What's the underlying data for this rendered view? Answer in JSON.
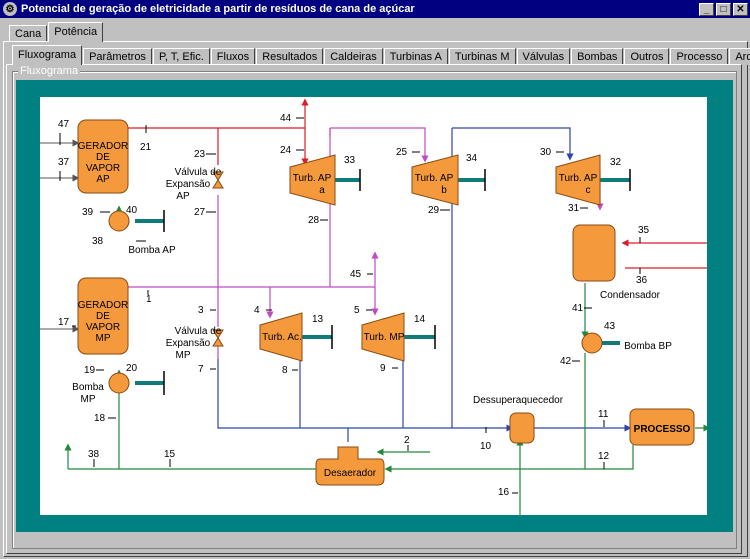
{
  "window": {
    "title": "Potencial de geração de eletricidade a partir de resíduos de cana de açúcar",
    "minimize": "_",
    "maximize": "□",
    "close": "✕"
  },
  "top_tabs": [
    "Cana",
    "Potência"
  ],
  "sub_tabs": [
    "Fluxograma",
    "Parâmetros",
    "P, T, Efic.",
    "Fluxos",
    "Resultados",
    "Caldeiras",
    "Turbinas A",
    "Turbinas M",
    "Válvulas",
    "Bombas",
    "Outros",
    "Processo",
    "Arquivos"
  ],
  "groupbox_label": "Fluxograma",
  "components": {
    "gerador_ap": [
      "GERADOR",
      "DE",
      "VAPOR",
      "AP"
    ],
    "gerador_mp": [
      "GERADOR",
      "DE",
      "VAPOR",
      "MP"
    ],
    "turb_ap_a": [
      "Turb. AP",
      "a"
    ],
    "turb_ap_b": [
      "Turb. AP",
      "b"
    ],
    "turb_ap_c": [
      "Turb. AP",
      "c"
    ],
    "turb_ac": "Turb. Ac.",
    "turb_mp": "Turb. MP",
    "processo": "PROCESSO",
    "desaerador": "Desaerador",
    "valve_ap": [
      "Válvula de",
      "Expansão",
      "AP"
    ],
    "valve_mp": [
      "Válvula de",
      "Expansão",
      "MP"
    ],
    "bomba_ap": "Bomba AP",
    "bomba_mp": [
      "Bomba",
      "MP"
    ],
    "bomba_bp": "Bomba BP",
    "condensador": "Condensador",
    "dessuperaquecedor": "Dessuperaquecedor"
  },
  "stream_numbers": {
    "s47": "47",
    "s37": "37",
    "s21": "21",
    "s39": "39",
    "s40": "40",
    "s38a": "38",
    "s23": "23",
    "s27": "27",
    "s44": "44",
    "s24": "24",
    "s33": "33",
    "s28": "28",
    "s25": "25",
    "s34": "34",
    "s29": "29",
    "s30": "30",
    "s32": "32",
    "s31": "31",
    "s35": "35",
    "s36": "36",
    "s41": "41",
    "s43": "43",
    "s42": "42",
    "s1": "1",
    "s17": "17",
    "s19": "19",
    "s20": "20",
    "s18": "18",
    "s3": "3",
    "s7": "7",
    "s4": "4",
    "s13": "13",
    "s8": "8",
    "s45": "45",
    "s5": "5",
    "s14": "14",
    "s9": "9",
    "s2": "2",
    "s10": "10",
    "s11": "11",
    "s12": "12",
    "s38b": "38",
    "s15": "15",
    "s16": "16"
  },
  "colors": {
    "equipment": "#f59a3c",
    "high_pressure": "#d81e2a",
    "medium_pressure": "#c04ac0",
    "low_pressure": "#2c45a8",
    "condensate": "#22893a",
    "shaft": "#117a7a",
    "teal_background": "#008080"
  }
}
